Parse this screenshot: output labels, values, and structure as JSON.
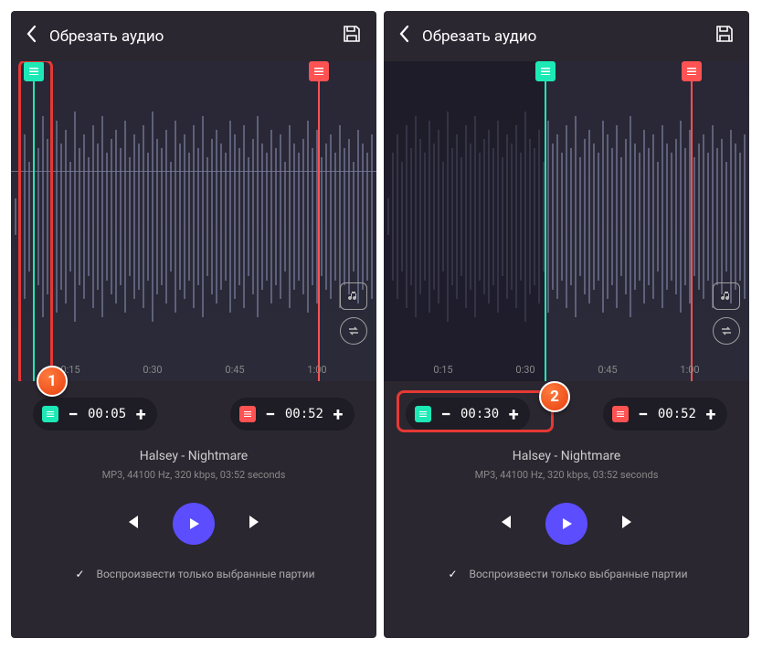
{
  "screens": [
    {
      "header": {
        "title": "Обрезать аудио"
      },
      "timeAxis": [
        "0:15",
        "0:30",
        "0:45",
        "1:00"
      ],
      "startMarker": {
        "time": "00:05",
        "positionPercent": 6
      },
      "endMarker": {
        "time": "00:52",
        "positionPercent": 84
      },
      "highlight": {
        "type": "vertical-marker",
        "badge": "1"
      },
      "track": {
        "title": "Halsey - Nightmare",
        "meta": "MP3, 44100 Hz, 320 kbps, 03:52 seconds"
      },
      "checkbox": {
        "label": "Воспроизвести только выбранные партии",
        "checked": true
      }
    },
    {
      "header": {
        "title": "Обрезать аудио"
      },
      "timeAxis": [
        "0:15",
        "0:30",
        "0:45",
        "1:00"
      ],
      "startMarker": {
        "time": "00:30",
        "positionPercent": 44
      },
      "endMarker": {
        "time": "00:52",
        "positionPercent": 84
      },
      "highlight": {
        "type": "time-pill",
        "badge": "2"
      },
      "track": {
        "title": "Halsey - Nightmare",
        "meta": "MP3, 44100 Hz, 320 kbps, 03:52 seconds"
      },
      "checkbox": {
        "label": "Воспроизвести только выбранные партии",
        "checked": true
      }
    }
  ],
  "icons": {
    "minus": "−",
    "plus": "+",
    "check": "✓"
  }
}
